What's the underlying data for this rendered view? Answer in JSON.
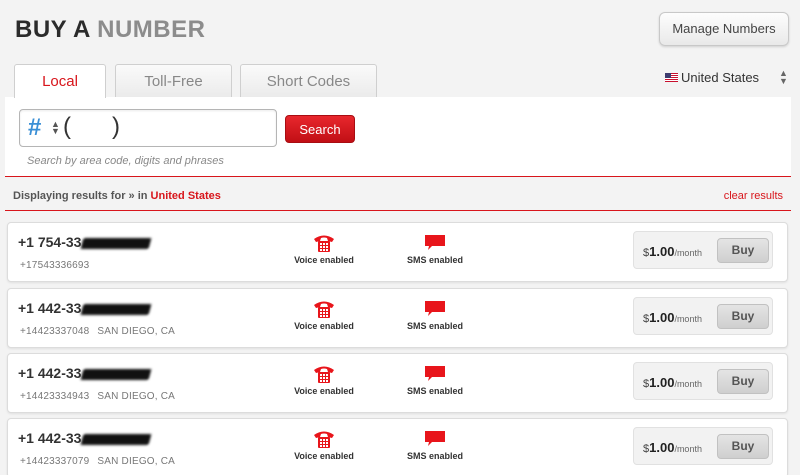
{
  "header": {
    "title_part1": "BUY A ",
    "title_part2": "NUMBER",
    "manage_label": "Manage Numbers"
  },
  "tabs": [
    {
      "label": "Local",
      "active": true
    },
    {
      "label": "Toll-Free",
      "active": false
    },
    {
      "label": "Short Codes",
      "active": false
    }
  ],
  "country": {
    "selected": "United States"
  },
  "search": {
    "prefix": "#",
    "open_paren": "(",
    "close_paren": ")",
    "button_label": "Search",
    "hint": "Search by area code, digits and phrases"
  },
  "results": {
    "prefix": "Displaying results for » in ",
    "country": "United States",
    "clear_label": "clear results"
  },
  "capabilities": {
    "voice_label": "Voice enabled",
    "sms_label": "SMS enabled"
  },
  "rows": [
    {
      "display": "+1 754-33",
      "raw": "+17543336693",
      "location": "",
      "currency": "$",
      "amount": "1.00",
      "period": "/month",
      "buy_label": "Buy"
    },
    {
      "display": "+1 442-33",
      "raw": "+14423337048",
      "location": "SAN DIEGO, CA",
      "currency": "$",
      "amount": "1.00",
      "period": "/month",
      "buy_label": "Buy"
    },
    {
      "display": "+1 442-33",
      "raw": "+14423334943",
      "location": "SAN DIEGO, CA",
      "currency": "$",
      "amount": "1.00",
      "period": "/month",
      "buy_label": "Buy"
    },
    {
      "display": "+1 442-33",
      "raw": "+14423337079",
      "location": "SAN DIEGO, CA",
      "currency": "$",
      "amount": "1.00",
      "period": "/month",
      "buy_label": "Buy"
    }
  ],
  "colors": {
    "accent": "#d8151b",
    "hash": "#3a8fd6"
  }
}
